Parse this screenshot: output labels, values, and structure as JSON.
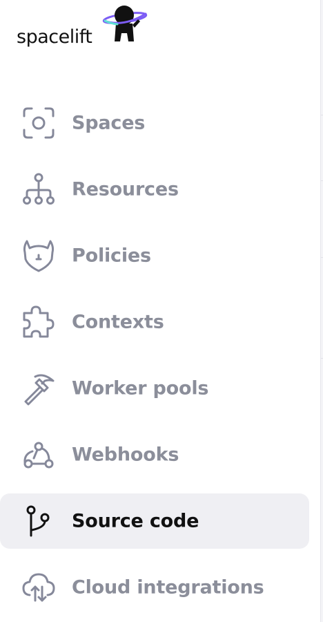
{
  "brand": {
    "name": "spacelift"
  },
  "nav": {
    "items": [
      {
        "label": "Spaces",
        "icon": "spaces-icon",
        "active": false
      },
      {
        "label": "Resources",
        "icon": "resources-icon",
        "active": false
      },
      {
        "label": "Policies",
        "icon": "policies-icon",
        "active": false
      },
      {
        "label": "Contexts",
        "icon": "contexts-icon",
        "active": false
      },
      {
        "label": "Worker pools",
        "icon": "worker-pools-icon",
        "active": false
      },
      {
        "label": "Webhooks",
        "icon": "webhooks-icon",
        "active": false
      },
      {
        "label": "Source code",
        "icon": "source-code-icon",
        "active": true
      },
      {
        "label": "Cloud integrations",
        "icon": "cloud-integrations-icon",
        "active": false
      }
    ]
  },
  "colors": {
    "text_muted": "#8b8e9a",
    "text_active": "#111111",
    "active_bg": "#efeff3",
    "logo_ring": "#7c5cf5",
    "logo_ring_accent": "#5ee0d4"
  }
}
